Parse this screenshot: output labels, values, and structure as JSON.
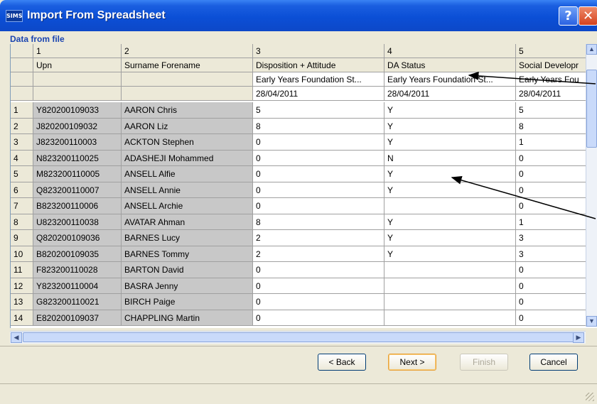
{
  "window": {
    "title": "Import From Spreadsheet",
    "app_badge": "SIMS",
    "help_symbol": "?",
    "close_symbol": "✕"
  },
  "section_label": "Data from file",
  "columns": {
    "numbers": [
      "1",
      "2",
      "3",
      "4",
      "5"
    ],
    "names": [
      "Upn",
      "Surname Forename",
      "Disposition + Attitude",
      "DA Status",
      "Social Developr"
    ],
    "groups": [
      "",
      "",
      "Early Years Foundation St...",
      "Early Years Foundation St...",
      "Early Years Fou"
    ],
    "dates": [
      "",
      "",
      "28/04/2011",
      "28/04/2011",
      "28/04/2011"
    ]
  },
  "rows": [
    {
      "n": "1",
      "upn": "Y820200109033",
      "name": "AARON Chris",
      "c3": "5",
      "c4": "Y",
      "c5": "5"
    },
    {
      "n": "2",
      "upn": "J820200109032",
      "name": "AARON Liz",
      "c3": "8",
      "c4": "Y",
      "c5": "8"
    },
    {
      "n": "3",
      "upn": "J823200110003",
      "name": "ACKTON Stephen",
      "c3": "0",
      "c4": "Y",
      "c5": "1"
    },
    {
      "n": "4",
      "upn": "N823200110025",
      "name": "ADASHEJI Mohammed",
      "c3": "0",
      "c4": "N",
      "c5": "0"
    },
    {
      "n": "5",
      "upn": "M823200110005",
      "name": "ANSELL Alfie",
      "c3": "0",
      "c4": "Y",
      "c5": "0"
    },
    {
      "n": "6",
      "upn": "Q823200110007",
      "name": "ANSELL Annie",
      "c3": "0",
      "c4": "Y",
      "c5": "0"
    },
    {
      "n": "7",
      "upn": "B823200110006",
      "name": "ANSELL Archie",
      "c3": "0",
      "c4": "",
      "c5": "0"
    },
    {
      "n": "8",
      "upn": "U823200110038",
      "name": "AVATAR Ahman",
      "c3": "8",
      "c4": "Y",
      "c5": "1"
    },
    {
      "n": "9",
      "upn": "Q820200109036",
      "name": "BARNES Lucy",
      "c3": "2",
      "c4": "Y",
      "c5": "3"
    },
    {
      "n": "10",
      "upn": "B820200109035",
      "name": "BARNES Tommy",
      "c3": "2",
      "c4": "Y",
      "c5": "3"
    },
    {
      "n": "11",
      "upn": "F823200110028",
      "name": "BARTON David",
      "c3": "0",
      "c4": "",
      "c5": "0"
    },
    {
      "n": "12",
      "upn": "Y823200110004",
      "name": "BASRA Jenny",
      "c3": "0",
      "c4": "",
      "c5": "0"
    },
    {
      "n": "13",
      "upn": "G823200110021",
      "name": "BIRCH Paige",
      "c3": "0",
      "c4": "",
      "c5": "0"
    },
    {
      "n": "14",
      "upn": "E820200109037",
      "name": "CHAPPLING Martin",
      "c3": "0",
      "c4": "",
      "c5": "0"
    }
  ],
  "buttons": {
    "back": "< Back",
    "next": "Next >",
    "finish": "Finish",
    "cancel": "Cancel"
  },
  "colors": {
    "title_bar": "#0b4fd6",
    "locked_cell": "#c8c8c8",
    "header": "#ece9d8"
  },
  "icons": {
    "scroll_up": "▲",
    "scroll_down": "▼",
    "scroll_left": "◀",
    "scroll_right": "▶"
  }
}
